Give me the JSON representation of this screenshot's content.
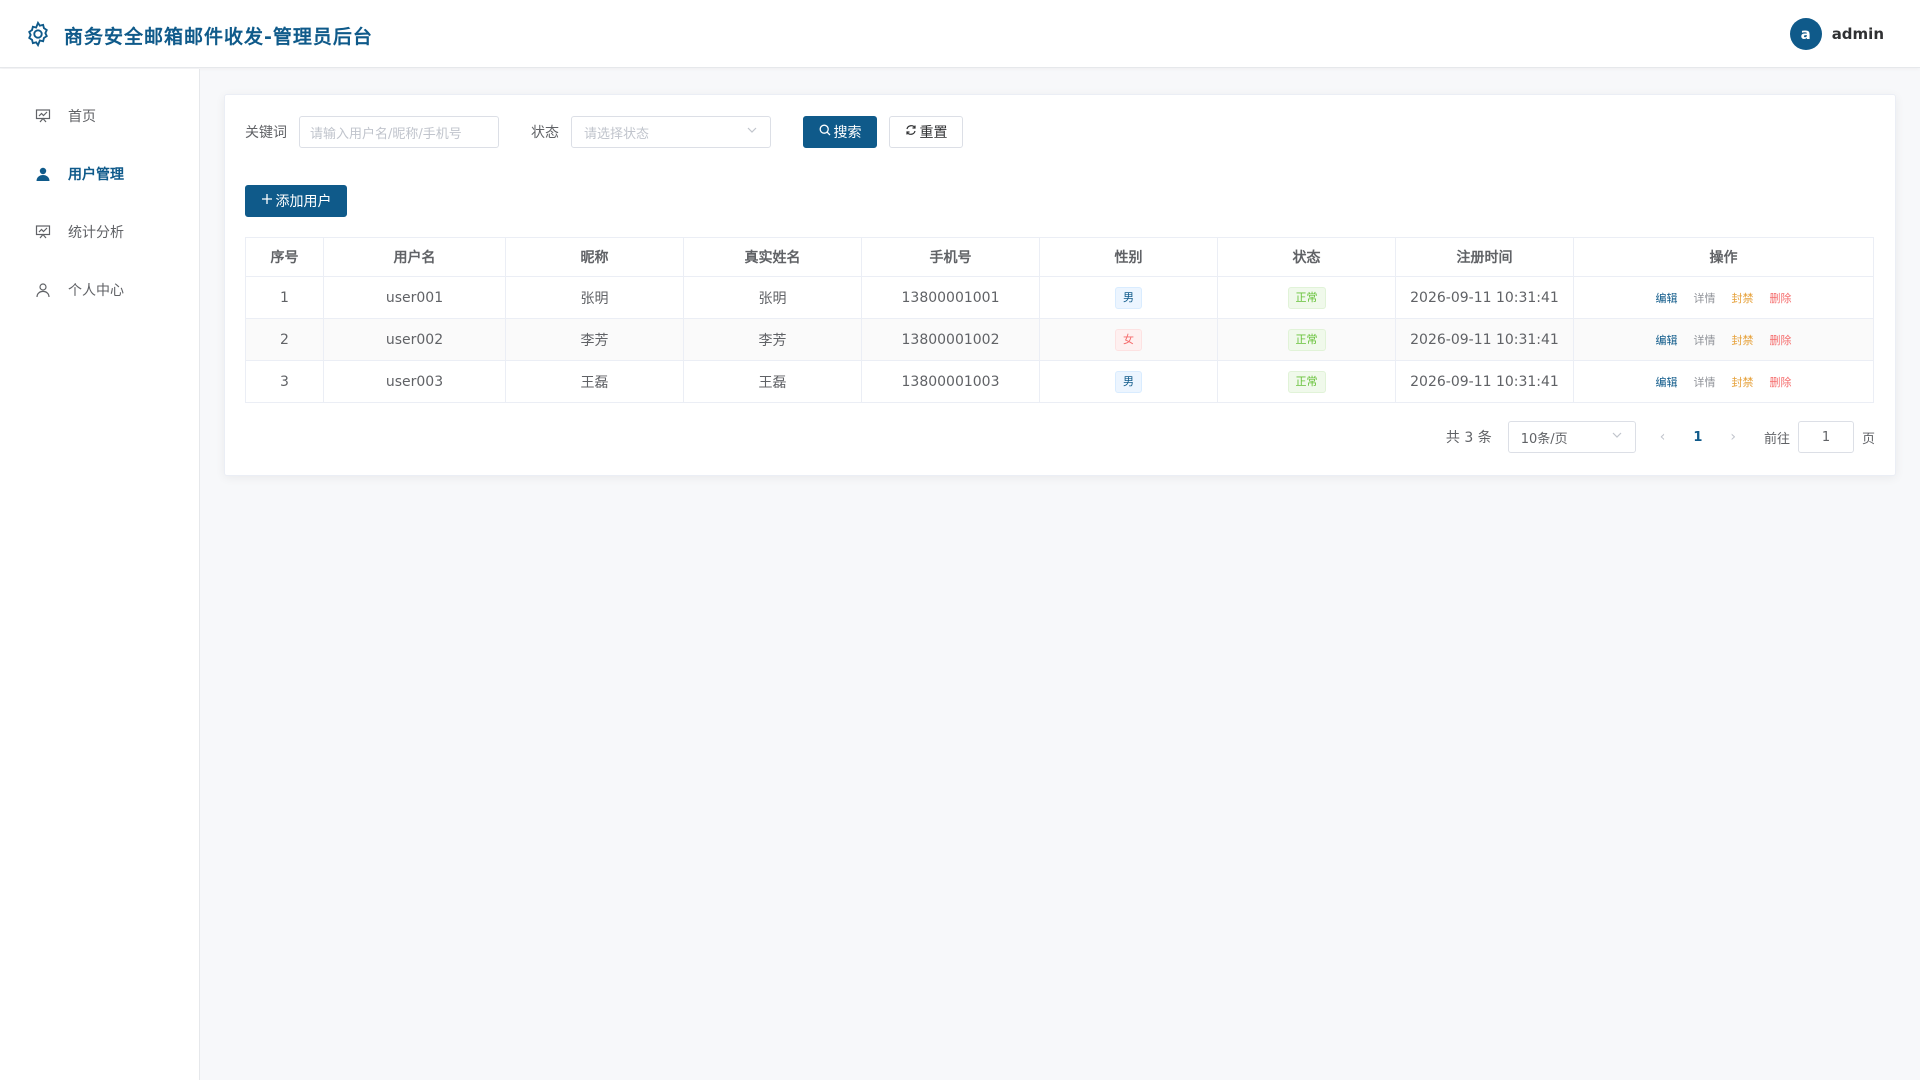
{
  "header": {
    "title": "商务安全邮箱邮件收发-管理员后台",
    "avatar_letter": "a",
    "username": "admin"
  },
  "sidebar": {
    "items": [
      {
        "label": "首页",
        "icon": "presentation-icon",
        "active": false
      },
      {
        "label": "用户管理",
        "icon": "user-icon",
        "active": true
      },
      {
        "label": "统计分析",
        "icon": "presentation-icon",
        "active": false
      },
      {
        "label": "个人中心",
        "icon": "user-outline-icon",
        "active": false
      }
    ]
  },
  "search": {
    "keyword_label": "关键词",
    "keyword_placeholder": "请输入用户名/昵称/手机号",
    "status_label": "状态",
    "status_placeholder": "请选择状态",
    "search_label": "搜索",
    "reset_label": "重置"
  },
  "toolbar": {
    "add_label": "添加用户"
  },
  "table": {
    "columns": [
      "序号",
      "用户名",
      "昵称",
      "真实姓名",
      "手机号",
      "性别",
      "状态",
      "注册时间",
      "操作"
    ],
    "rows": [
      {
        "index": "1",
        "username": "user001",
        "nickname": "张明",
        "realname": "张明",
        "phone": "13800001001",
        "gender": "男",
        "status": "正常",
        "registered": "2026-09-11 10:31:41"
      },
      {
        "index": "2",
        "username": "user002",
        "nickname": "李芳",
        "realname": "李芳",
        "phone": "13800001002",
        "gender": "女",
        "status": "正常",
        "registered": "2026-09-11 10:31:41"
      },
      {
        "index": "3",
        "username": "user003",
        "nickname": "王磊",
        "realname": "王磊",
        "phone": "13800001003",
        "gender": "男",
        "status": "正常",
        "registered": "2026-09-11 10:31:41"
      }
    ],
    "actions": {
      "edit": "编辑",
      "detail": "详情",
      "ban": "封禁",
      "delete": "删除"
    }
  },
  "pagination": {
    "total_text": "共 3 条",
    "page_size": "10条/页",
    "current_page": "1",
    "goto_label": "前往",
    "goto_value": "1",
    "page_suffix": "页"
  },
  "colors": {
    "primary": "#0f5a8a",
    "male_tag": "#0f5a8a",
    "female_tag": "#f56c6c",
    "normal_tag": "#67c23a",
    "ban": "#e6a23c",
    "delete": "#f56c6c"
  }
}
